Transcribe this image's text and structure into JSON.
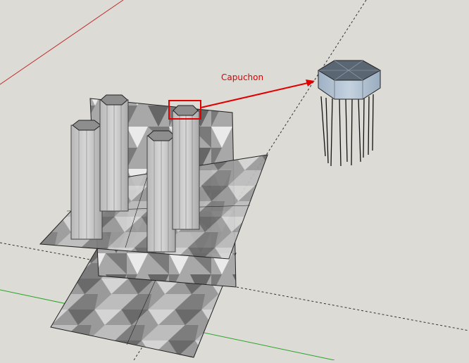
{
  "viewport": {
    "background": "#dcdbd5",
    "callout": {
      "label": "Capuchon",
      "color": "#e00000"
    },
    "axes": {
      "red_axis_color": "#c03030",
      "green_axis_color": "#2aa52a",
      "guide_line_color": "#333333"
    },
    "model": {
      "column_count": 4,
      "detail_rod_count": 10,
      "column_fill": "#c9c9c9",
      "cap_fill": "#b4c4d4",
      "checker_dark": "#6e6e6e",
      "checker_light": "#cfcfcf"
    }
  }
}
